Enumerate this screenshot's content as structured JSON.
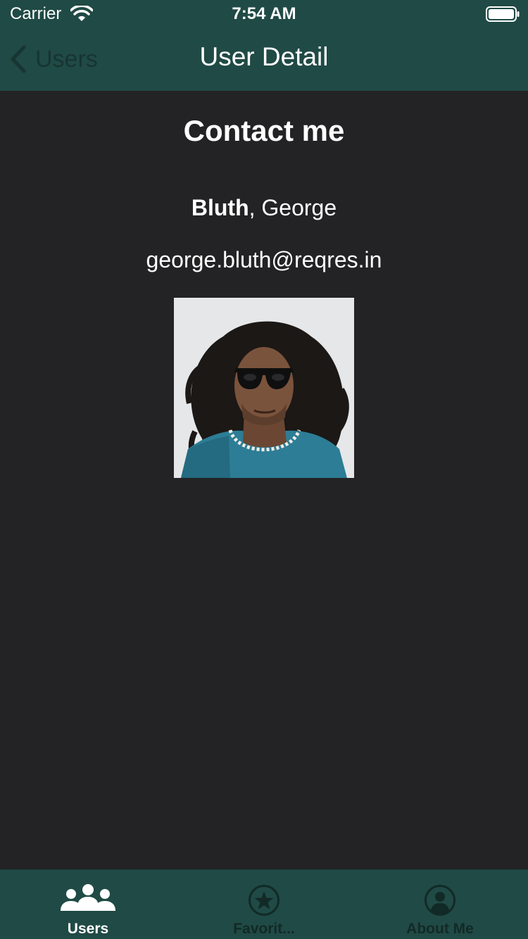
{
  "status_bar": {
    "carrier": "Carrier",
    "time": "7:54 AM"
  },
  "nav_bar": {
    "back_label": "Users",
    "title": "User Detail"
  },
  "contact": {
    "heading": "Contact me",
    "last_name": "Bluth",
    "separator": ", ",
    "first_name": "George",
    "email": "george.bluth@reqres.in"
  },
  "tab_bar": {
    "items": [
      {
        "label": "Users",
        "icon": "users-icon",
        "selected": true
      },
      {
        "label": "Favorit...",
        "icon": "star-circle-icon",
        "selected": false
      },
      {
        "label": "About Me",
        "icon": "person-circle-icon",
        "selected": false
      }
    ]
  },
  "colors": {
    "header_bg": "#204a45",
    "content_bg": "#232325",
    "text": "#ffffff",
    "inactive_tab": "#122a27"
  }
}
